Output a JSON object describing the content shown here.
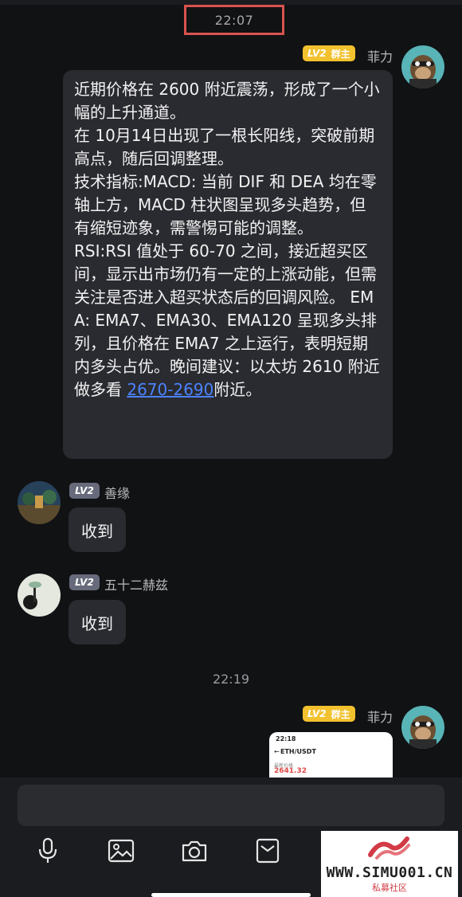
{
  "chat": {
    "time_top": "22:07",
    "time_mid": "22:19",
    "messages": [
      {
        "sender": "菲力",
        "level": "LV2",
        "role": "群主",
        "text_main": "近期价格在 2600 附近震荡，形成了一个小幅的上升通道。\n在 10月14日出现了一根长阳线，突破前期高点，随后回调整理。\n技术指标:MACD: 当前 DIF 和 DEA 均在零轴上方，MACD 柱状图呈现多头趋势，但有缩短迹象，需警惕可能的调整。\nRSI:RSI 值处于 60-70 之间，接近超买区间，显示出市场仍有一定的上涨动能，但需关注是否进入超买状态后的回调风险。 EMA: EMA7、EMA30、EMA120 呈现多头排列，且价格在 EMA7 之上运行，表明短期内多头占优。晚间建议：以太坊 2610 附近做多看 ",
        "text_link": "2670-2690",
        "text_tail": "附近。"
      },
      {
        "sender": "善缘",
        "level": "LV2",
        "text": "收到"
      },
      {
        "sender": "五十二赫兹",
        "level": "LV2",
        "text": "收到"
      },
      {
        "sender": "菲力",
        "level": "LV2",
        "role": "群主",
        "preview": {
          "status_time": "22:18",
          "pair": "ETH/USDT",
          "label": "最新价格",
          "price": "2641.32"
        }
      }
    ]
  },
  "composer": {
    "icons": [
      "microphone-icon",
      "image-icon",
      "camera-icon",
      "mailbox-icon"
    ]
  },
  "watermark": {
    "url": "WWW.SIMU001.CN",
    "subtitle": "私募社区"
  },
  "colors": {
    "background": "#111214",
    "bubble": "#2a2b30",
    "link": "#4b82ff",
    "owner_badge": "#f2c12e",
    "member_badge": "#666a7a",
    "highlight_box": "#d9534f"
  }
}
